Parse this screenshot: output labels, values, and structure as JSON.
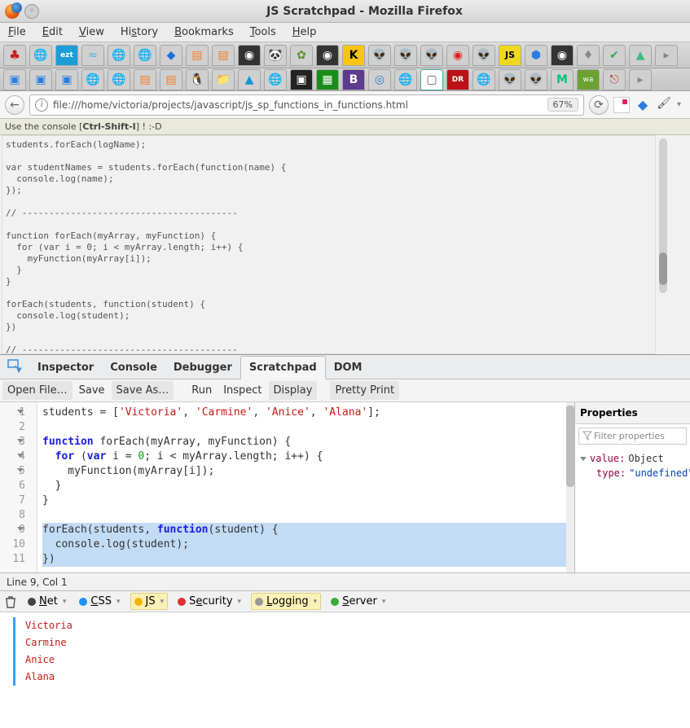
{
  "window": {
    "title": "JS Scratchpad - Mozilla Firefox"
  },
  "menubar": {
    "file": "File",
    "edit": "Edit",
    "view": "View",
    "history": "History",
    "bookmarks": "Bookmarks",
    "tools": "Tools",
    "help": "Help"
  },
  "url": "file:///home/victoria/projects/javascript/js_sp_functions_in_functions.html",
  "zoom": "67%",
  "infobar": {
    "prefix": "Use the console [ ",
    "shortcut": "Ctrl-Shift-I",
    "suffix": " ] ! :-D"
  },
  "page_code": "students.forEach(logName);\n\nvar studentNames = students.forEach(function(name) {\n  console.log(name);\n});\n\n// ----------------------------------------\n\nfunction forEach(myArray, myFunction) {\n  for (var i = 0; i < myArray.length; i++) {\n    myFunction(myArray[i]);\n  }\n}\n\nforEach(students, function(student) {\n  console.log(student);\n})\n\n// ----------------------------------------",
  "devtools": {
    "tabs": {
      "inspector": "Inspector",
      "console": "Console",
      "debugger": "Debugger",
      "scratchpad": "Scratchpad",
      "dom": "DOM"
    }
  },
  "scratchpad_toolbar": {
    "open_file": "Open File…",
    "save": "Save",
    "save_as": "Save As…",
    "run": "Run",
    "inspect": "Inspect",
    "display": "Display",
    "pretty_print": "Pretty Print"
  },
  "code": {
    "lines": [
      "students = ['Victoria', 'Carmine', 'Anice', 'Alana'];",
      "",
      "function forEach(myArray, myFunction) {",
      "  for (var i = 0; i < myArray.length; i++) {",
      "    myFunction(myArray[i]);",
      "  }",
      "}",
      "",
      "forEach(students, function(student) {",
      "  console.log(student);",
      "})"
    ],
    "fold_lines": [
      1,
      3,
      4,
      5,
      9
    ]
  },
  "properties": {
    "title": "Properties",
    "filter_placeholder": "Filter properties",
    "rows": {
      "value_key": "value:",
      "value_val": "Object",
      "type_key": "type:",
      "type_val": "\"undefined\""
    }
  },
  "status": "Line 9, Col 1",
  "console_tabs": {
    "net": "Net",
    "css": "CSS",
    "js": "JS",
    "security": "Security",
    "logging": "Logging",
    "server": "Server"
  },
  "console_output": [
    "Victoria",
    "Carmine",
    "Anice",
    "Alana"
  ]
}
